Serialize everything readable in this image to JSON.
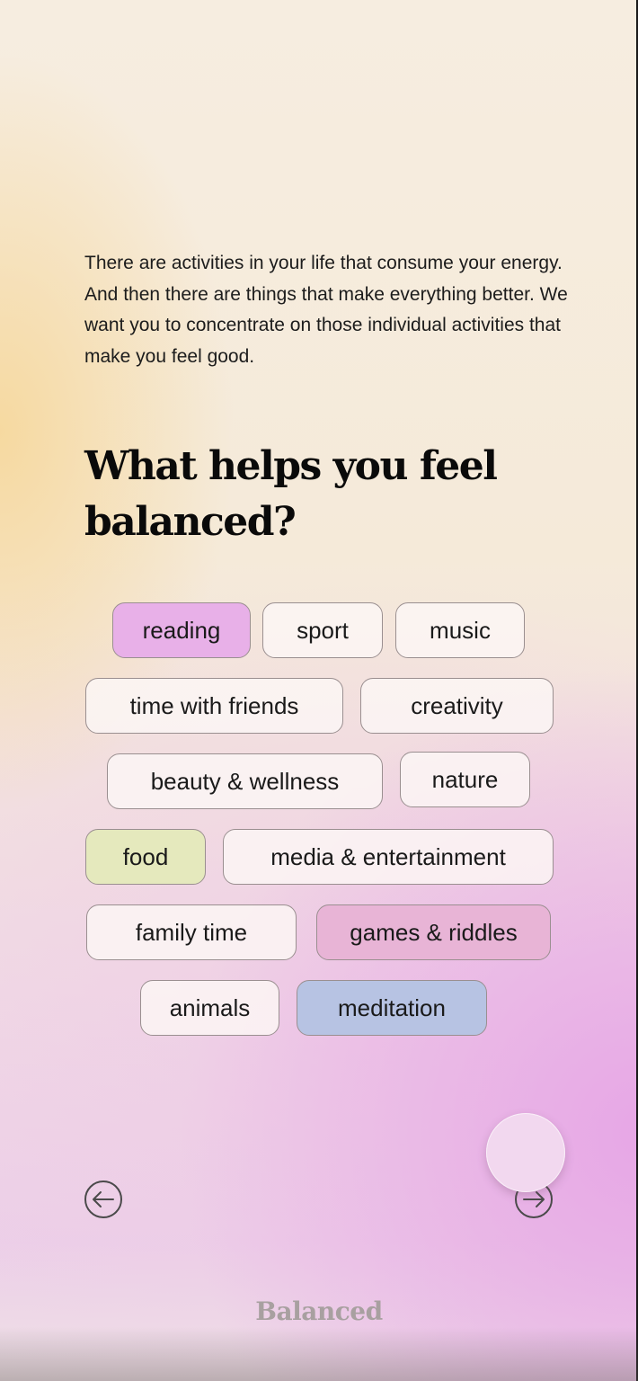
{
  "intro": {
    "text": "There are activities in your life that consume your energy. And then there are things that make everything better. We want you to concentrate on those individual activities that make you feel good."
  },
  "question": {
    "title": "What helps you feel balanced?"
  },
  "options": [
    {
      "label": "reading",
      "selected": true,
      "color": "#e8b0e8"
    },
    {
      "label": "sport",
      "selected": false
    },
    {
      "label": "music",
      "selected": false
    },
    {
      "label": "time with friends",
      "selected": false
    },
    {
      "label": "creativity",
      "selected": false
    },
    {
      "label": "beauty & wellness",
      "selected": false
    },
    {
      "label": "nature",
      "selected": false
    },
    {
      "label": "food",
      "selected": true,
      "color": "#e5e9bd"
    },
    {
      "label": "media & entertainment",
      "selected": false
    },
    {
      "label": "family time",
      "selected": false
    },
    {
      "label": "games & riddles",
      "selected": true,
      "color": "#e8b4d6"
    },
    {
      "label": "animals",
      "selected": false
    },
    {
      "label": "meditation",
      "selected": true,
      "color": "#b7c3e3"
    }
  ],
  "navigation": {
    "back_icon": "arrow-left-icon",
    "next_icon": "arrow-right-icon"
  },
  "footer": {
    "brand": "Balanced"
  },
  "colors": {
    "text": "#1a1a1a",
    "chip_border": "#9a8f90",
    "brand": "#a8a0a0"
  }
}
